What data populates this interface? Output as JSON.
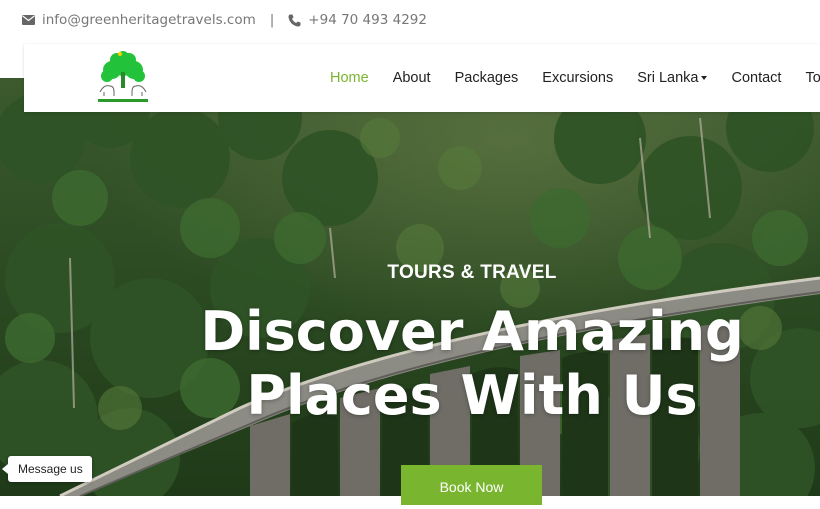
{
  "contact": {
    "email": "info@greenheritagetravels.com",
    "separator": "|",
    "phone": "+94 70 493 4292"
  },
  "icons": {
    "email": "envelope-icon",
    "phone": "phone-icon",
    "dropdown": "caret-down-icon"
  },
  "logo_alt": "Green Heritage Travels",
  "nav": {
    "items": [
      {
        "label": "Home",
        "active": true
      },
      {
        "label": "About"
      },
      {
        "label": "Packages"
      },
      {
        "label": "Excursions"
      },
      {
        "label": "Sri Lanka",
        "dropdown": true
      },
      {
        "label": "Contact"
      },
      {
        "label": "To"
      }
    ]
  },
  "hero": {
    "kicker": "TOURS & TRAVEL",
    "headline_line1": "Discover Amazing",
    "headline_line2": "Places With Us",
    "cta": "Book Now"
  },
  "chat": {
    "label": "Message us"
  },
  "colors": {
    "accent": "#7ab52f",
    "text_muted": "#777777"
  }
}
